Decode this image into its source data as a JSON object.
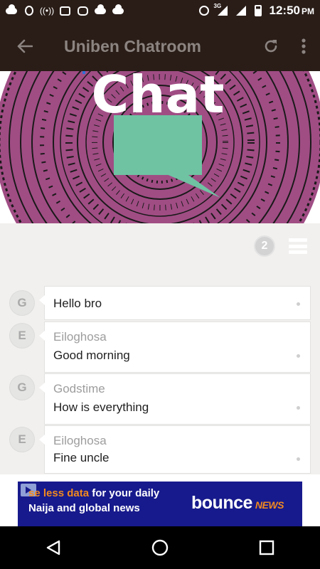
{
  "status_bar": {
    "time": "12:50",
    "ampm": "PM",
    "network": "3G",
    "left_icons": [
      "cloud-icon",
      "opera-icon",
      "hotspot-icon",
      "image-icon",
      "instagram-icon",
      "cloud-icon",
      "cloud-icon"
    ],
    "right_icons": [
      "hotspot-icon",
      "signal-icon",
      "signal-empty-icon",
      "battery-charging-icon"
    ]
  },
  "app_bar": {
    "title": "Uniben Chatroom",
    "back_icon": "arrow-left-icon",
    "refresh_icon": "refresh-icon",
    "more_icon": "more-vert-icon",
    "background": "#2a1d18",
    "text_color": "#8c8480"
  },
  "banner": {
    "text": "Chat",
    "background": "#a04d84",
    "bubble_color": "#6fc3a3"
  },
  "toolbar": {
    "badge_count": "2",
    "menu_icon": "hamburger-icon"
  },
  "messages": [
    {
      "avatar": "G",
      "sender": "",
      "text": "Hello bro"
    },
    {
      "avatar": "E",
      "sender": "Eiloghosa",
      "text": "Good morning"
    },
    {
      "avatar": "G",
      "sender": "Godstime",
      "text": "How is everything"
    },
    {
      "avatar": "E",
      "sender": "Eiloghosa",
      "text": "Fine uncle"
    }
  ],
  "ad": {
    "line1_highlight": "se less data",
    "line1_rest": " for your daily",
    "line2": "Naija and global news",
    "brand": "bounce",
    "brand_suffix": "NEWS",
    "background": "#171a8c",
    "accent": "#f28a1f"
  },
  "nav_bar": {
    "back_icon": "nav-back-icon",
    "home_icon": "nav-home-icon",
    "recents_icon": "nav-recents-icon"
  }
}
